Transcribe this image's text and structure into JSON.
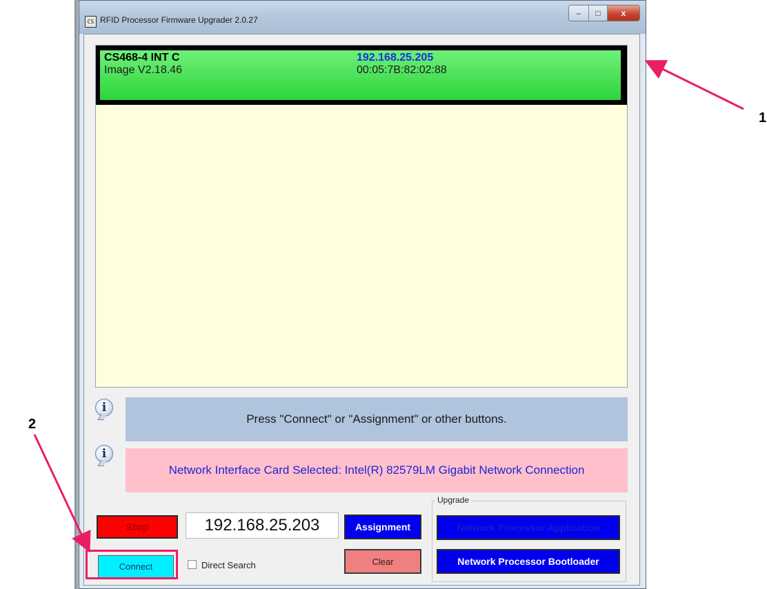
{
  "window": {
    "title": "RFID Processor Firmware Upgrader 2.0.27",
    "icon_text": "CS",
    "controls": {
      "minimize": "–",
      "maximize": "□",
      "close": "x"
    }
  },
  "device_list": {
    "devices": [
      {
        "model": "CS468-4 INT C",
        "image": "Image V2.18.46",
        "ip": "192.168.25.205",
        "mac": "00:05:7B:82:02:88"
      }
    ],
    "background_color": "#ffffe0",
    "selected_row_color": "#2ed43b"
  },
  "status": {
    "message": "Press \"Connect\" or \"Assignment\" or other buttons.",
    "nic": "Network Interface Card Selected: Intel(R) 82579LM Gigabit Network Connection"
  },
  "controls": {
    "stop_label": "Stop",
    "ip_value": "192.168.25.203",
    "assignment_label": "Assignment",
    "connect_label": "Connect",
    "direct_search_label": "Direct Search",
    "direct_search_checked": false,
    "clear_label": "Clear"
  },
  "upgrade": {
    "group_label": "Upgrade",
    "np_application_label": "Network Processor Application",
    "np_bootloader_label": "Network Processor Bootloader"
  },
  "annotations": {
    "callout_1": "1",
    "callout_2": "2",
    "arrow_color": "#e91e63"
  }
}
